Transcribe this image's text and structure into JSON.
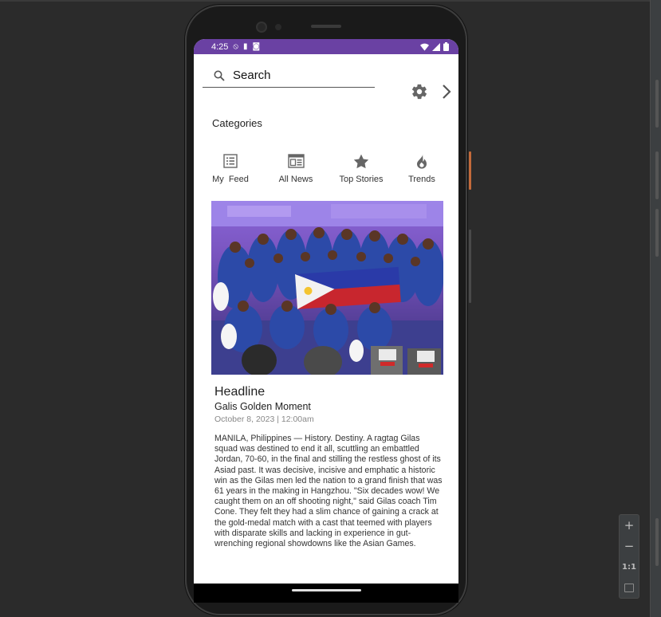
{
  "status_bar": {
    "time": "4:25",
    "icons": [
      "privacy-shield-icon",
      "sim-card-icon",
      "notification-icon"
    ],
    "right_icons": [
      "wifi-icon",
      "signal-icon",
      "battery-icon"
    ]
  },
  "search": {
    "placeholder": "Search",
    "icon": "search-icon"
  },
  "toolbar": {
    "settings_icon": "gear-icon",
    "next_icon": "chevron-right-icon"
  },
  "categories": {
    "title": "Categories",
    "items": [
      {
        "label": "My  Feed",
        "icon": "list-icon"
      },
      {
        "label": "All News",
        "icon": "newspaper-icon"
      },
      {
        "label": "Top Stories",
        "icon": "star-icon"
      },
      {
        "label": "Trends",
        "icon": "flame-icon"
      }
    ]
  },
  "article": {
    "headline": "Headline",
    "subheadline": "Galis Golden Moment",
    "date": "October 8, 2023 | 12:00am",
    "body": "MANILA, Philippines — History. Destiny.  A ragtag Gilas squad was destined to end it all, scuttling an embattled Jordan, 70-60, in the final and stilling the restless ghost of its Asiad past.  It was decisive, incisive and emphatic a historic win as the Gilas men led the nation to a grand finish that was 61 years in the making in Hangzhou. \"Six decades wow! We caught them on an off shooting night,\" said Gilas coach Tim Cone.  They felt they had a slim chance of gaining a crack at the gold-medal match with a cast that teemed with players with disparate skills and lacking in experience in gut-wrenching regional showdowns like the Asian Games.",
    "image": "team-celebration-photo"
  },
  "zoom_controls": {
    "zoom_in": "+",
    "zoom_out": "−",
    "actual_size": "1:1",
    "fit_icon": "fit-screen-icon"
  },
  "colors": {
    "status_bar": "#6a41a3",
    "background": "#2b2b2b",
    "screen": "#ffffff"
  }
}
